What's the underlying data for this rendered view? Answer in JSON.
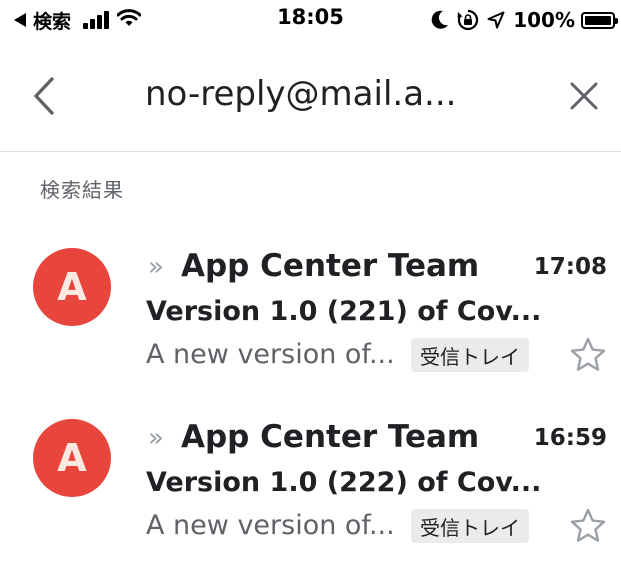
{
  "status_bar": {
    "back_label": "検索",
    "time": "18:05",
    "battery": "100%"
  },
  "header": {
    "title": "no-reply@mail.a..."
  },
  "section_label": "検索結果",
  "emails": [
    {
      "avatar_letter": "A",
      "chevrons": "»",
      "sender": "App Center Team",
      "time": "17:08",
      "subject": "Version 1.0 (221) of Cov...",
      "snippet": "A new version of...",
      "label": "受信トレイ"
    },
    {
      "avatar_letter": "A",
      "chevrons": "»",
      "sender": "App Center Team",
      "time": "16:59",
      "subject": "Version 1.0 (222) of Cov...",
      "snippet": "A new version of...",
      "label": "受信トレイ"
    }
  ],
  "colors": {
    "avatar_bg": "#e8453c",
    "avatar_fg": "#fde8e2",
    "label_bg": "#ebebeb",
    "divider": "#dadce0"
  },
  "icons": [
    "back-triangle-icon",
    "cellular-signal-icon",
    "wifi-icon",
    "moon-icon",
    "rotation-lock-icon",
    "location-arrow-icon",
    "battery-icon",
    "back-chevron-icon",
    "close-icon",
    "star-outline-icon"
  ]
}
